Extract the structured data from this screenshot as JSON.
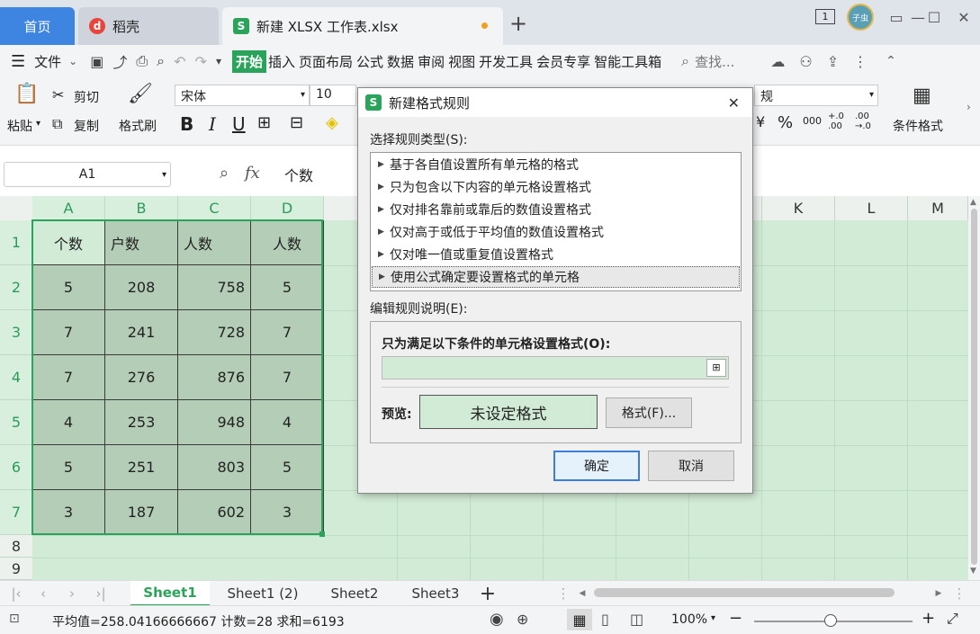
{
  "tabs": {
    "home": "首页",
    "daoke": "稻壳",
    "file": "新建 XLSX 工作表.xlsx",
    "new_tab": "+"
  },
  "window": {
    "badge": "1",
    "avatar": "子虫"
  },
  "menu": {
    "file": "文件",
    "items": [
      "开始",
      "插入",
      "页面布局",
      "公式",
      "数据",
      "审阅",
      "视图",
      "开发工具",
      "会员专享",
      "智能工具箱"
    ],
    "search": "查找..."
  },
  "ribbon": {
    "paste": "粘贴",
    "cut": "剪切",
    "copy": "复制",
    "format_painter": "格式刷",
    "font_name": "宋体",
    "font_size": "10",
    "bold": "B",
    "italic": "I",
    "underline": "U",
    "number_format": "规",
    "percent": "%",
    "thousands": "000",
    "inc_decimal": "+.0 .00",
    "dec_decimal": ".00 →.0",
    "conditional_format": "条件格式"
  },
  "formula_bar": {
    "name_box": "A1",
    "fx": "fx",
    "content": "个数"
  },
  "sheet": {
    "columns": [
      "A",
      "B",
      "C",
      "D",
      "K",
      "L",
      "M"
    ],
    "rows": [
      "1",
      "2",
      "3",
      "4",
      "5",
      "6",
      "7",
      "8",
      "9"
    ],
    "header_row": [
      "个数",
      "户数",
      "人数",
      "人数"
    ],
    "data": [
      [
        "5",
        "208",
        "758",
        "5"
      ],
      [
        "7",
        "241",
        "728",
        "7"
      ],
      [
        "7",
        "276",
        "876",
        "7"
      ],
      [
        "4",
        "253",
        "948",
        "4"
      ],
      [
        "5",
        "251",
        "803",
        "5"
      ],
      [
        "3",
        "187",
        "602",
        "3"
      ]
    ]
  },
  "sheet_tabs": [
    "Sheet1",
    "Sheet1 (2)",
    "Sheet2",
    "Sheet3"
  ],
  "status": {
    "summary": "平均值=258.04166666667  计数=28  求和=6193",
    "zoom": "100%"
  },
  "dialog": {
    "title": "新建格式规则",
    "select_type_label": "选择规则类型(S):",
    "rules": [
      "基于各自值设置所有单元格的格式",
      "只为包含以下内容的单元格设置格式",
      "仅对排名靠前或靠后的数值设置格式",
      "仅对高于或低于平均值的数值设置格式",
      "仅对唯一值或重复值设置格式",
      "使用公式确定要设置格式的单元格"
    ],
    "edit_desc_label": "编辑规则说明(E):",
    "condition_label": "只为满足以下条件的单元格设置格式(O):",
    "preview_label": "预览:",
    "preview_text": "未设定格式",
    "format_button": "格式(F)...",
    "ok": "确定",
    "cancel": "取消"
  }
}
